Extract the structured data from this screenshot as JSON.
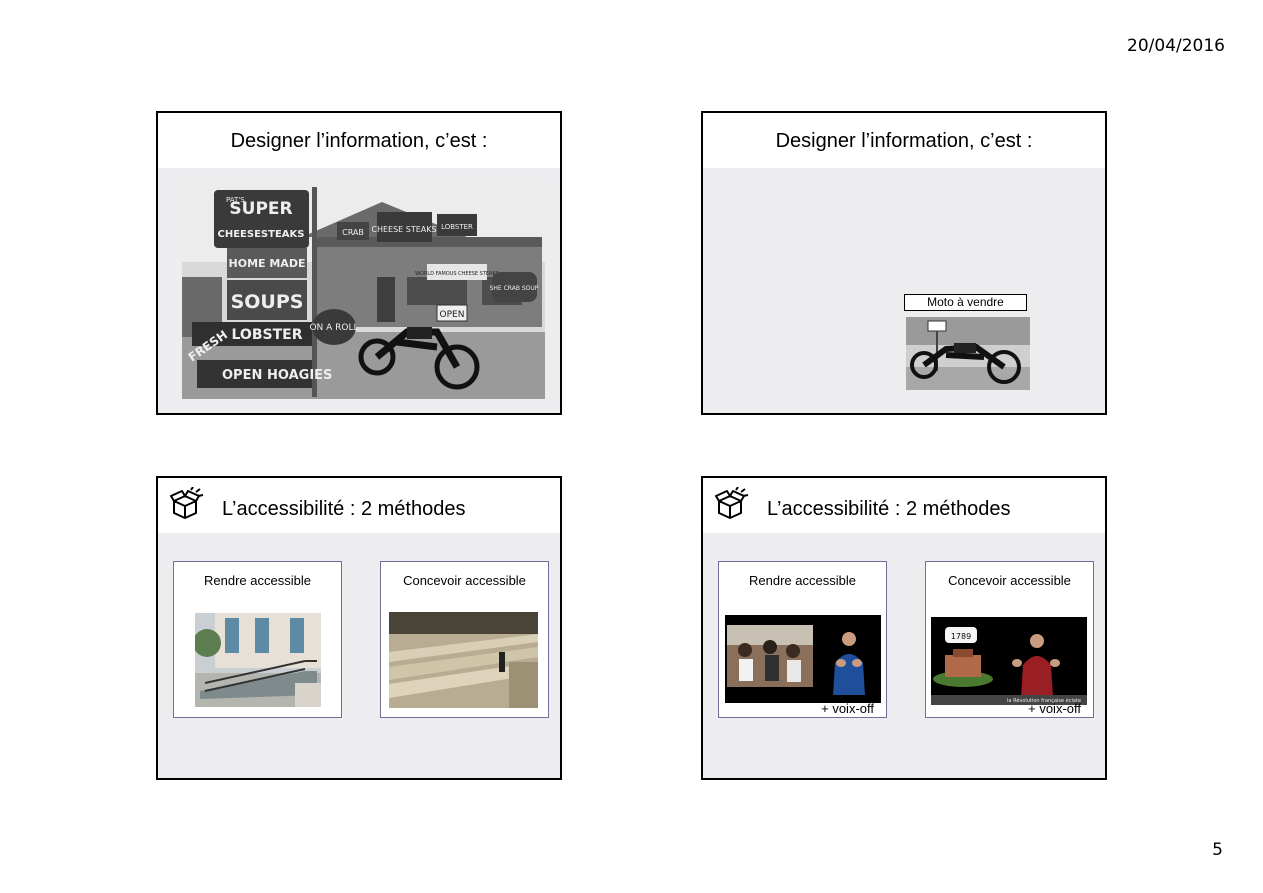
{
  "header": {
    "date": "20/04/2016"
  },
  "footer": {
    "page_number": "5"
  },
  "slides": [
    {
      "title": "Designer l’information, c’est :",
      "image": "black-and-white photo of roadside seafood shack with signs and a motorcycle",
      "signs": [
        "PAT'S",
        "SUPER",
        "CHEESESTEAKS",
        "HOME MADE",
        "SOUPS",
        "LOBSTER",
        "FRESH",
        "ON A ROLL",
        "OPEN",
        "HOAGIES",
        "CRAB",
        "CHEESE STEAKS",
        "LOBSTER",
        "WORLD FAMOUS CHEESE STEAKS",
        "SHE CRAB SOUP",
        "OPEN"
      ]
    },
    {
      "title": "Designer l’information, c’est :",
      "label": "Moto à vendre",
      "image": "small photo of a motorcycle"
    },
    {
      "title": "L’accessibilité : 2 méthodes",
      "icon": "box-icon",
      "cards": [
        {
          "title": "Rendre accessible",
          "image": "photo of a wheelchair ramp in front of a building"
        },
        {
          "title": "Concevoir accessible",
          "image": "photo of stairs integrated with a ramp"
        }
      ]
    },
    {
      "title": "L’accessibilité : 2 méthodes",
      "icon": "box-icon",
      "cards": [
        {
          "title": "Rendre accessible",
          "image": "video still with sign language interpreter",
          "note": "+ voix-off"
        },
        {
          "title": "Concevoir accessible",
          "image": "animated video with sign language interpreter",
          "badge": "1789",
          "caption": "la Révolution française éclate",
          "note": "+ voix-off"
        }
      ]
    }
  ]
}
